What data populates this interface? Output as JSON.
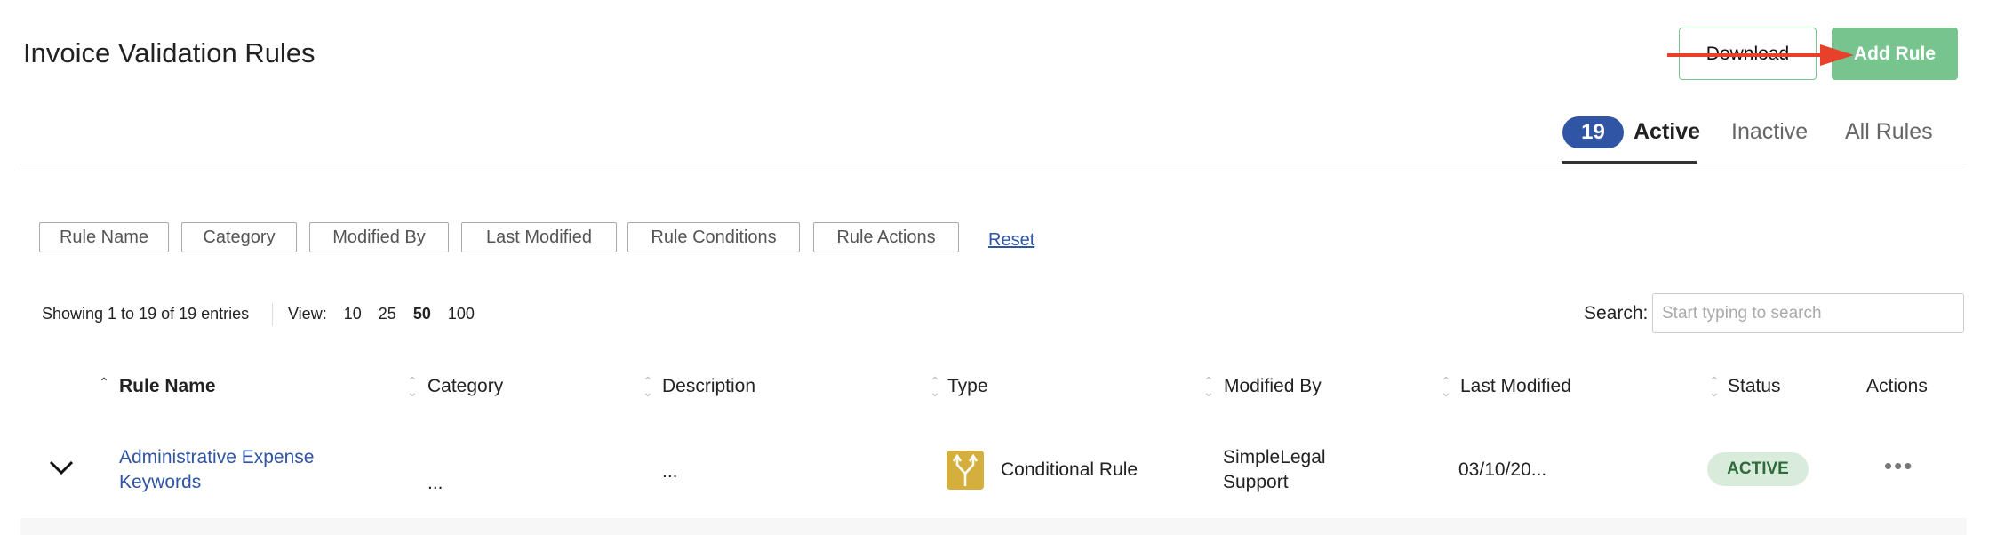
{
  "header": {
    "title": "Invoice Validation Rules",
    "download_label": "Download",
    "add_rule_label": "Add Rule"
  },
  "tabs": {
    "count": "19",
    "active": "Active",
    "inactive": "Inactive",
    "all": "All Rules"
  },
  "filters": [
    "Rule Name",
    "Category",
    "Modified By",
    "Last Modified",
    "Rule Conditions",
    "Rule Actions"
  ],
  "reset_label": "Reset",
  "table_info": {
    "showing": "Showing 1 to 19 of 19 entries",
    "view_label": "View:",
    "view_options": [
      "10",
      "25",
      "50",
      "100"
    ],
    "view_selected": "50"
  },
  "search": {
    "label": "Search:",
    "placeholder": "Start typing to search"
  },
  "columns": [
    "Rule Name",
    "Category",
    "Description",
    "Type",
    "Modified By",
    "Last Modified",
    "Status",
    "Actions"
  ],
  "rows": [
    {
      "name_line1": "Administrative Expense",
      "name_line2": "Keywords",
      "category": "...",
      "description": "...",
      "type": "Conditional Rule",
      "type_icon": "split-arrows-icon",
      "modified_by_1": "SimpleLegal",
      "modified_by_2": "Support",
      "last_modified": "03/10/20...",
      "status": "ACTIVE"
    }
  ],
  "colors": {
    "accent": "#2f55a4",
    "add_button": "#77c48e",
    "annotation_arrow": "#e8402a",
    "type_icon_bg": "#d4af3d"
  }
}
